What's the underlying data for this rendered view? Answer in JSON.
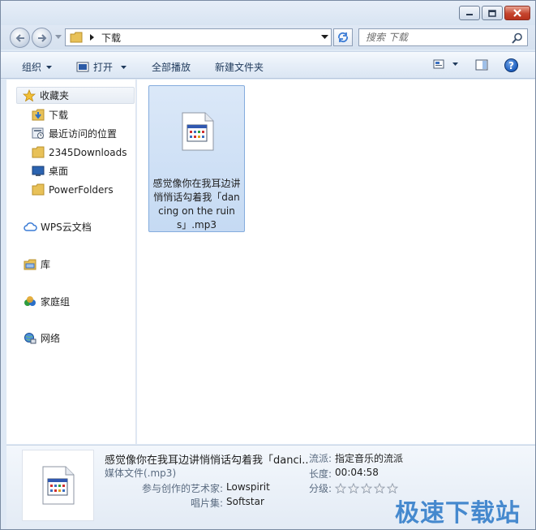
{
  "window": {
    "caption_buttons": [
      "minimize",
      "maximize",
      "close"
    ]
  },
  "address": {
    "path": "下载"
  },
  "search": {
    "placeholder": "搜索 下载"
  },
  "toolbar": {
    "organize": "组织",
    "open": "打开",
    "play_all": "全部播放",
    "new_folder": "新建文件夹"
  },
  "sidebar": {
    "favorites": "收藏夹",
    "items": [
      {
        "label": "下载",
        "icon": "download-folder-icon"
      },
      {
        "label": "最近访问的位置",
        "icon": "recent-places-icon"
      },
      {
        "label": "2345Downloads",
        "icon": "folder-icon"
      },
      {
        "label": "桌面",
        "icon": "desktop-icon"
      },
      {
        "label": "PowerFolders",
        "icon": "folder-icon"
      }
    ],
    "wps": "WPS云文档",
    "libraries": "库",
    "homegroup": "家庭组",
    "network": "网络"
  },
  "files": [
    {
      "name": "感觉像你在我耳边讲悄悄话勾着我「dancing on the ruins」.mp3",
      "icon": "media-file-icon"
    }
  ],
  "details": {
    "title": "感觉像你在我耳边讲悄悄话勾着我「danci...",
    "type": "媒体文件(.mp3)",
    "artist_label": "参与创作的艺术家:",
    "artist": "Lowspirit",
    "album_label": "唱片集:",
    "album": "Softstar",
    "genre_label": "流派:",
    "genre": "指定音乐的流派",
    "length_label": "长度:",
    "length": "00:04:58",
    "rating_label": "分级:",
    "rating": 0
  },
  "watermark": "极速下载站",
  "colors": {
    "accent": "#2a78c8",
    "selection": "#c5daf3"
  }
}
